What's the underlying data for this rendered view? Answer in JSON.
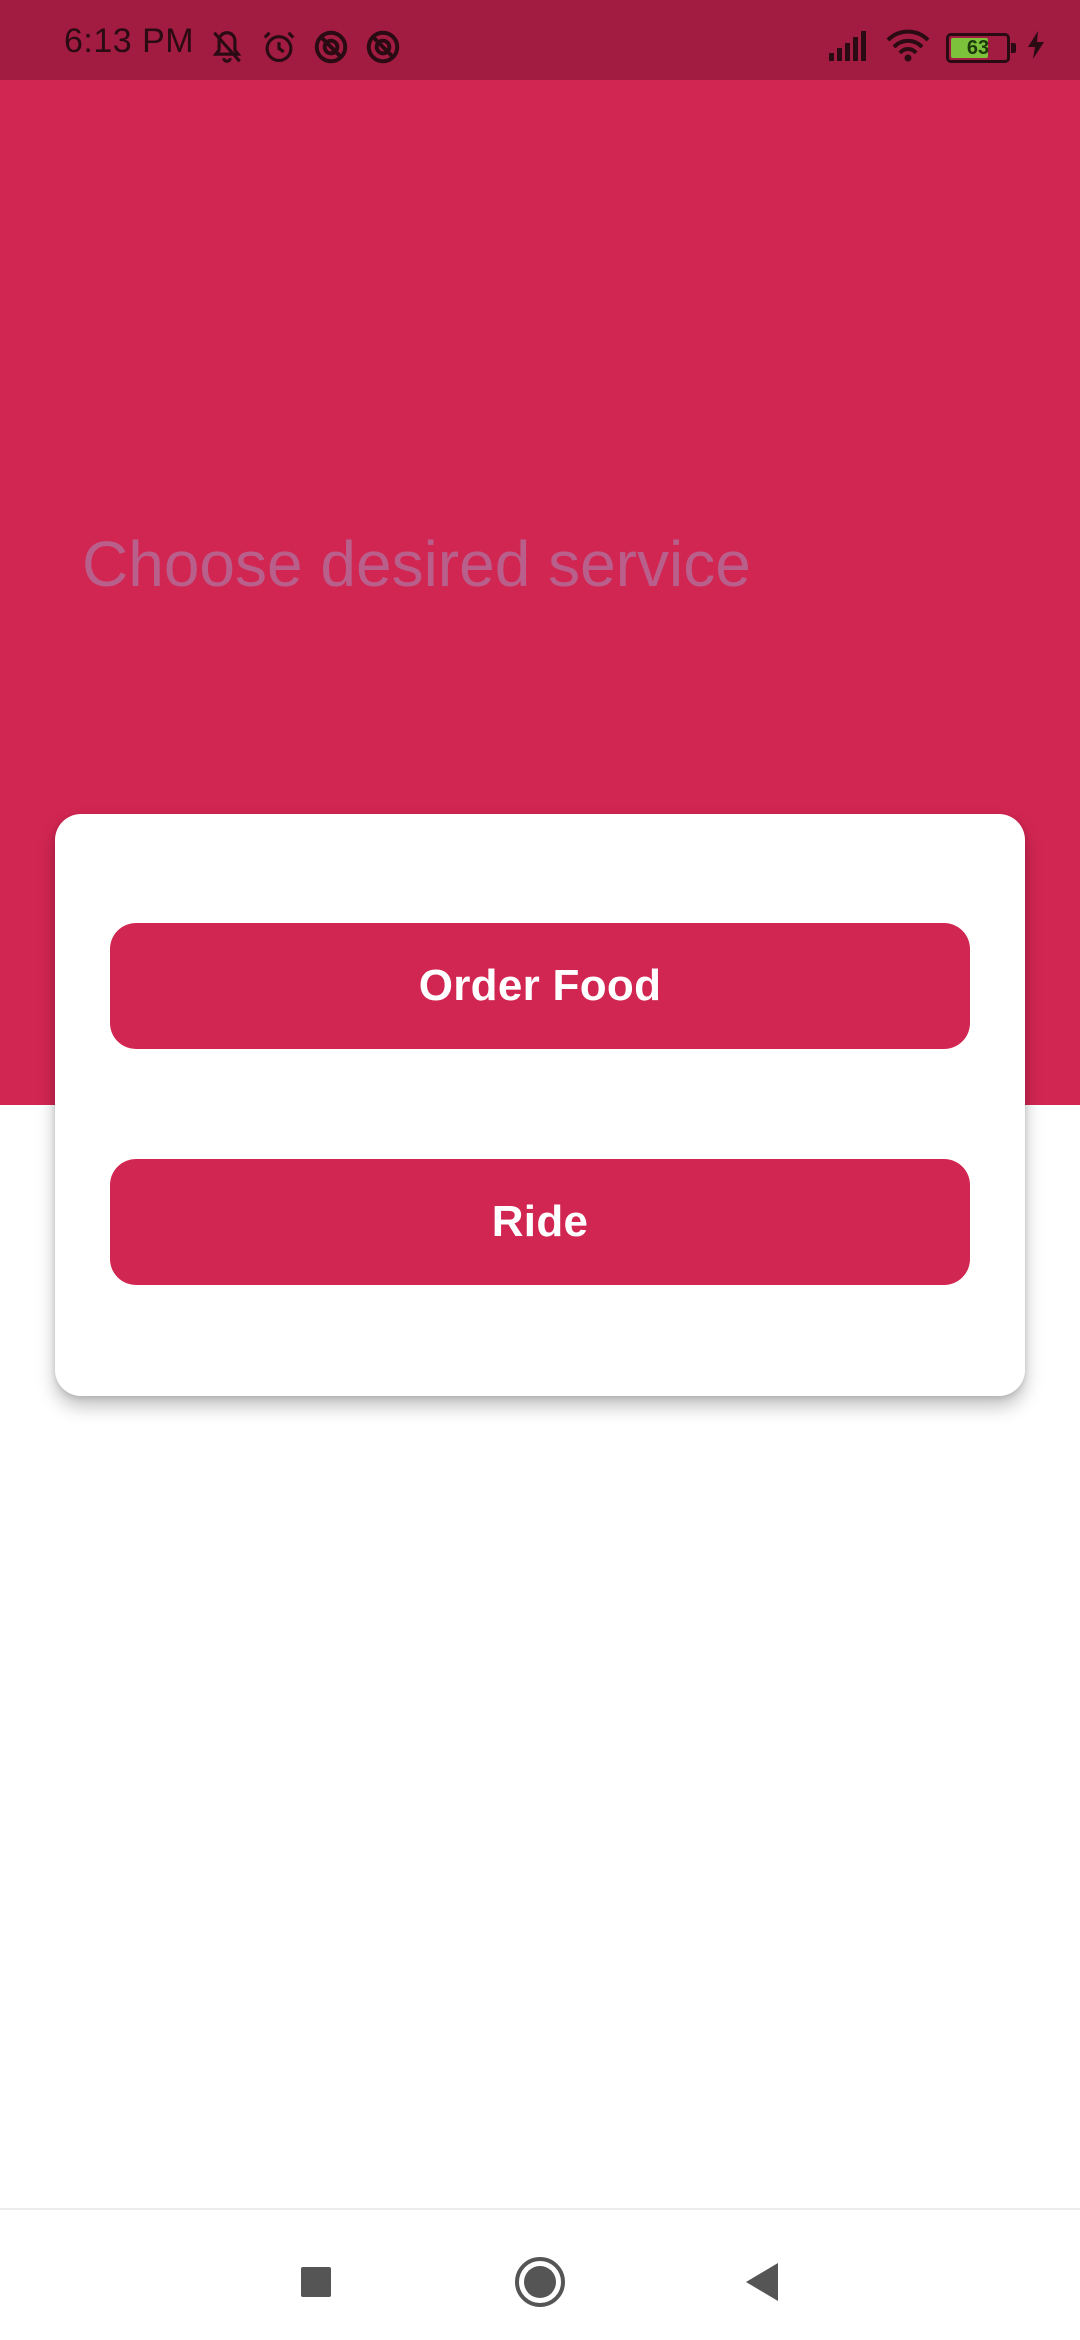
{
  "status_bar": {
    "time": "6:13 PM",
    "left_icons": [
      "mute-bell-icon",
      "alarm-icon",
      "app-notification-icon",
      "app-notification-icon"
    ],
    "right_icons": [
      "signal-icon",
      "wifi-icon",
      "battery-icon",
      "charging-icon"
    ],
    "battery_level": "63",
    "background": "#a11c40"
  },
  "hero": {
    "title": "Choose desired service",
    "background": "#d22652",
    "title_color": "#b8608b"
  },
  "services": {
    "order_food_label": "Order Food",
    "ride_label": "Ride",
    "button_color": "#d22652"
  },
  "nav_bar": {
    "icons": [
      "recent-apps-icon",
      "home-icon",
      "back-icon"
    ]
  }
}
